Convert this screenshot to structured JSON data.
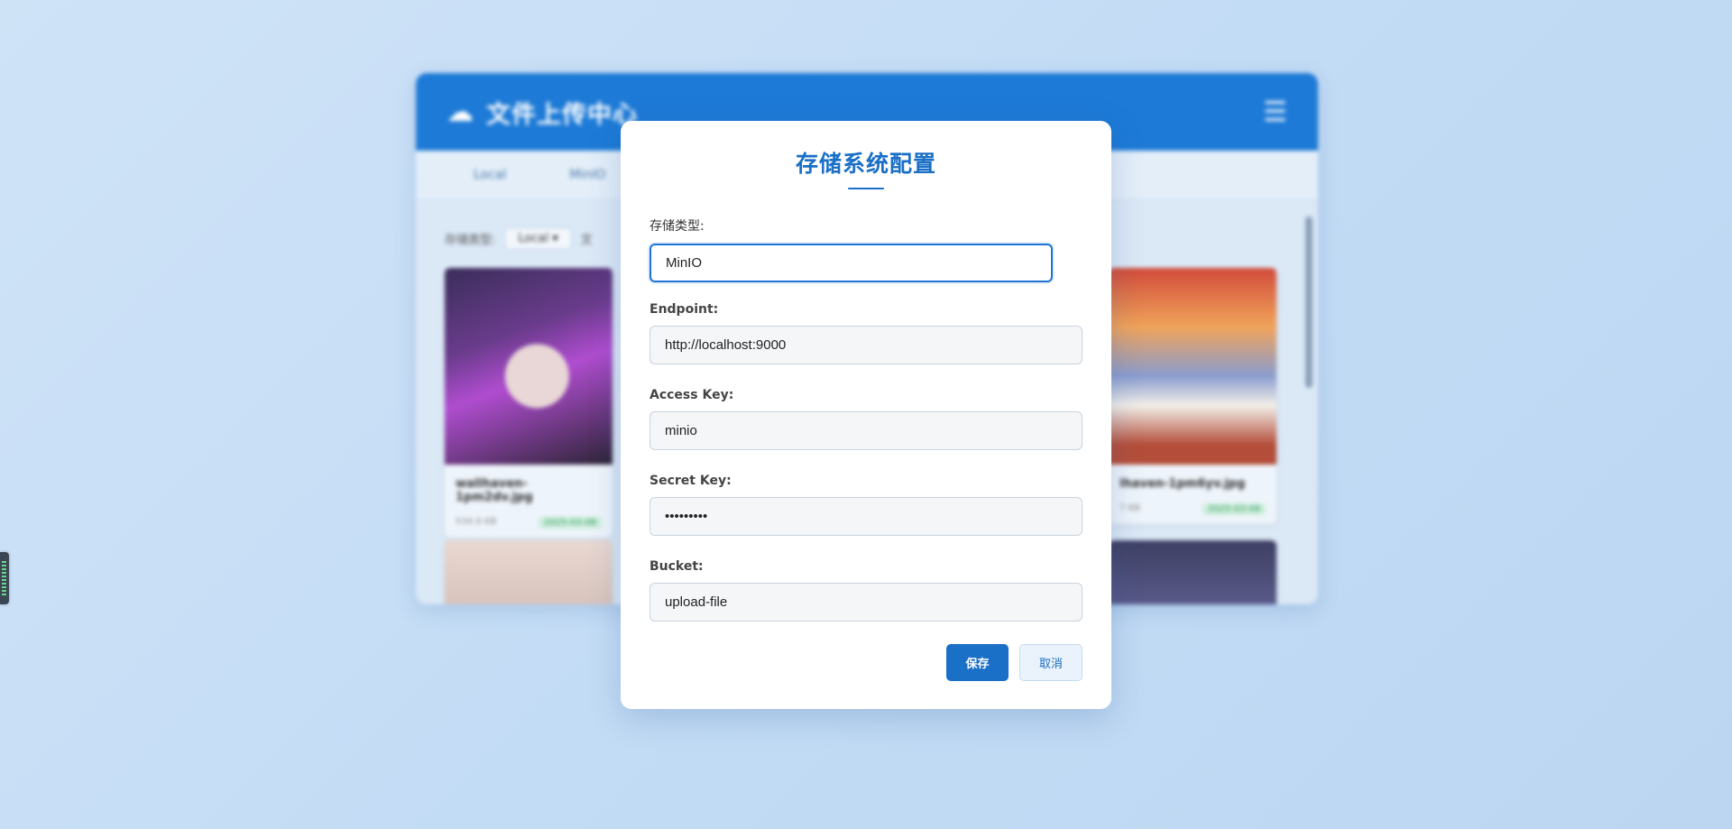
{
  "background_app": {
    "title": "文件上传中心",
    "cloud_icon": "☁",
    "menu_icon": "☰",
    "tabs": [
      "Local",
      "MinIO"
    ],
    "filter": {
      "label": "存储类型:",
      "selected": "Local",
      "extra": "文"
    },
    "cards": [
      {
        "name": "wallhaven-1pm2dv.jpg",
        "size": "534.9 KB",
        "date": "2025-03-08"
      },
      {
        "name": "lhaven-1pm6yv.jpg",
        "size": "7 KB",
        "date": "2025-03-08"
      }
    ]
  },
  "modal": {
    "title": "存储系统配置",
    "fields": {
      "storage_type": {
        "label": "存储类型:",
        "value": "MinIO"
      },
      "endpoint": {
        "label": "Endpoint:",
        "value": "http://localhost:9000"
      },
      "access_key": {
        "label": "Access Key:",
        "value": "minio"
      },
      "secret_key": {
        "label": "Secret Key:",
        "value": "•••••••••"
      },
      "bucket": {
        "label": "Bucket:",
        "value": "upload-file"
      }
    },
    "buttons": {
      "save": "保存",
      "cancel": "取消"
    }
  },
  "colors": {
    "primary": "#1a6fc6",
    "header": "#1d7ad6",
    "page_bg": "#c3dcf5"
  }
}
